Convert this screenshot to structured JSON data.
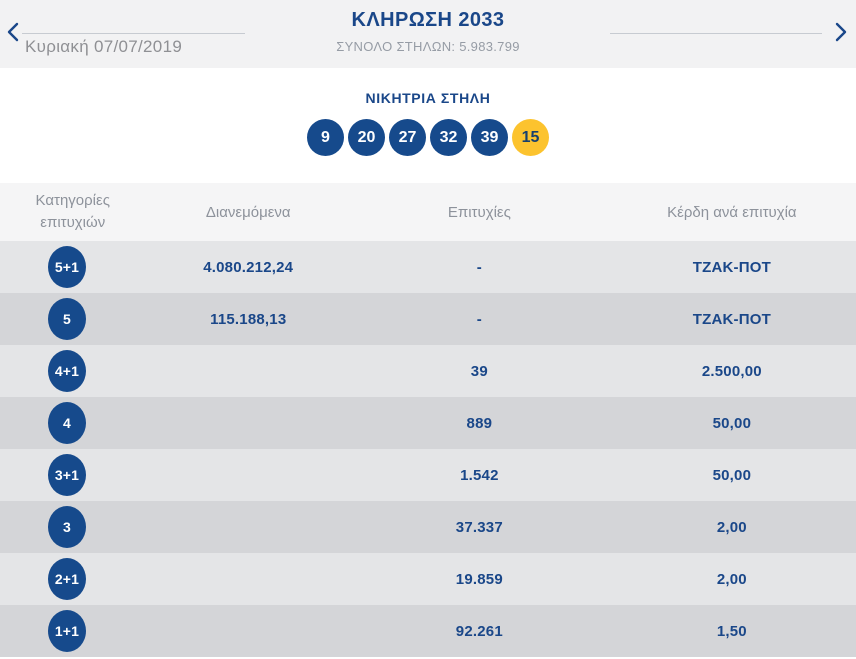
{
  "colors": {
    "navy": "#1a4789",
    "badge_navy": "#164a8c",
    "bonus_yellow": "#fcc32e",
    "band_gray": "#f2f2f3",
    "row_light": "#e4e5e7",
    "row_dark": "#d4d5d8",
    "muted_text": "#8d929b"
  },
  "header": {
    "title": "ΚΛΗΡΩΣΗ 2033",
    "total_columns_label": "ΣΥΝΟΛΟ ΣΤΗΛΩΝ: 5.983.799",
    "date": "Κυριακή 07/07/2019",
    "prev_icon": "chevron-left",
    "next_icon": "chevron-right"
  },
  "winning": {
    "heading": "ΝΙΚΗΤΡΙΑ ΣΤΗΛΗ",
    "numbers": [
      {
        "value": "9",
        "type": "main"
      },
      {
        "value": "20",
        "type": "main"
      },
      {
        "value": "27",
        "type": "main"
      },
      {
        "value": "32",
        "type": "main"
      },
      {
        "value": "39",
        "type": "main"
      },
      {
        "value": "15",
        "type": "bonus"
      }
    ]
  },
  "table": {
    "columns": {
      "category": "Κατηγορίες επιτυχιών",
      "distributed": "Διανεμόμενα",
      "winners": "Επιτυχίες",
      "prize": "Κέρδη ανά επιτυχία"
    },
    "rows": [
      {
        "category": "5+1",
        "distributed": "4.080.212,24",
        "winners": "-",
        "prize": "ΤΖΑΚ-ΠΟΤ"
      },
      {
        "category": "5",
        "distributed": "115.188,13",
        "winners": "-",
        "prize": "ΤΖΑΚ-ΠΟΤ"
      },
      {
        "category": "4+1",
        "distributed": "",
        "winners": "39",
        "prize": "2.500,00"
      },
      {
        "category": "4",
        "distributed": "",
        "winners": "889",
        "prize": "50,00"
      },
      {
        "category": "3+1",
        "distributed": "",
        "winners": "1.542",
        "prize": "50,00"
      },
      {
        "category": "3",
        "distributed": "",
        "winners": "37.337",
        "prize": "2,00"
      },
      {
        "category": "2+1",
        "distributed": "",
        "winners": "19.859",
        "prize": "2,00"
      },
      {
        "category": "1+1",
        "distributed": "",
        "winners": "92.261",
        "prize": "1,50"
      }
    ]
  }
}
